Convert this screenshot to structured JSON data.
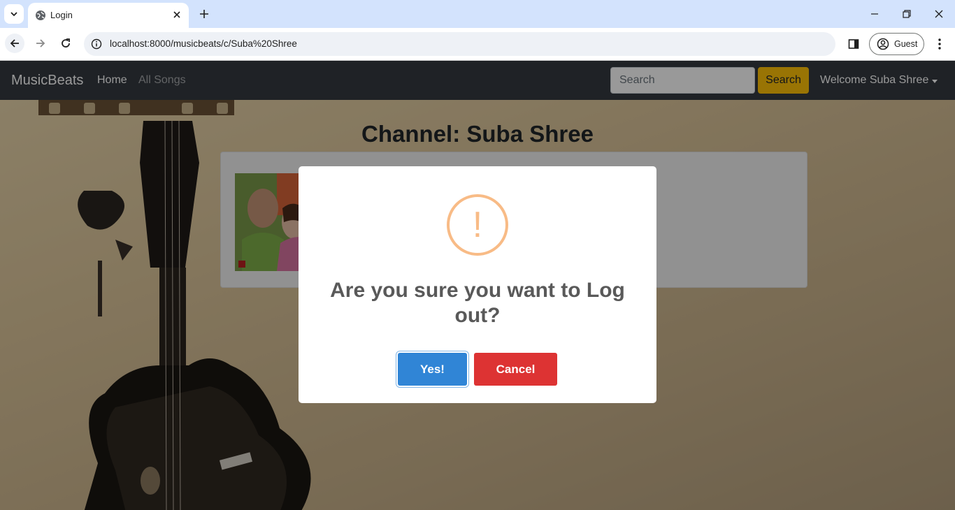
{
  "browser": {
    "tab_title": "Login",
    "url": "localhost:8000/musicbeats/c/Suba%20Shree",
    "profile_label": "Guest"
  },
  "navbar": {
    "brand": "MusicBeats",
    "home": "Home",
    "all_songs": "All Songs",
    "search_placeholder": "Search",
    "search_button": "Search",
    "user_menu": "Welcome Suba Shree"
  },
  "main": {
    "channel_title": "Channel: Suba Shree"
  },
  "dialog": {
    "icon": "!",
    "title": "Are you sure you want to Log out?",
    "confirm": "Yes!",
    "cancel": "Cancel"
  },
  "colors": {
    "navbar_bg": "#343a40",
    "search_button_bg": "#ffc107",
    "confirm_bg": "#3085d6",
    "cancel_bg": "#dd3333",
    "warning": "#f8bb86"
  }
}
